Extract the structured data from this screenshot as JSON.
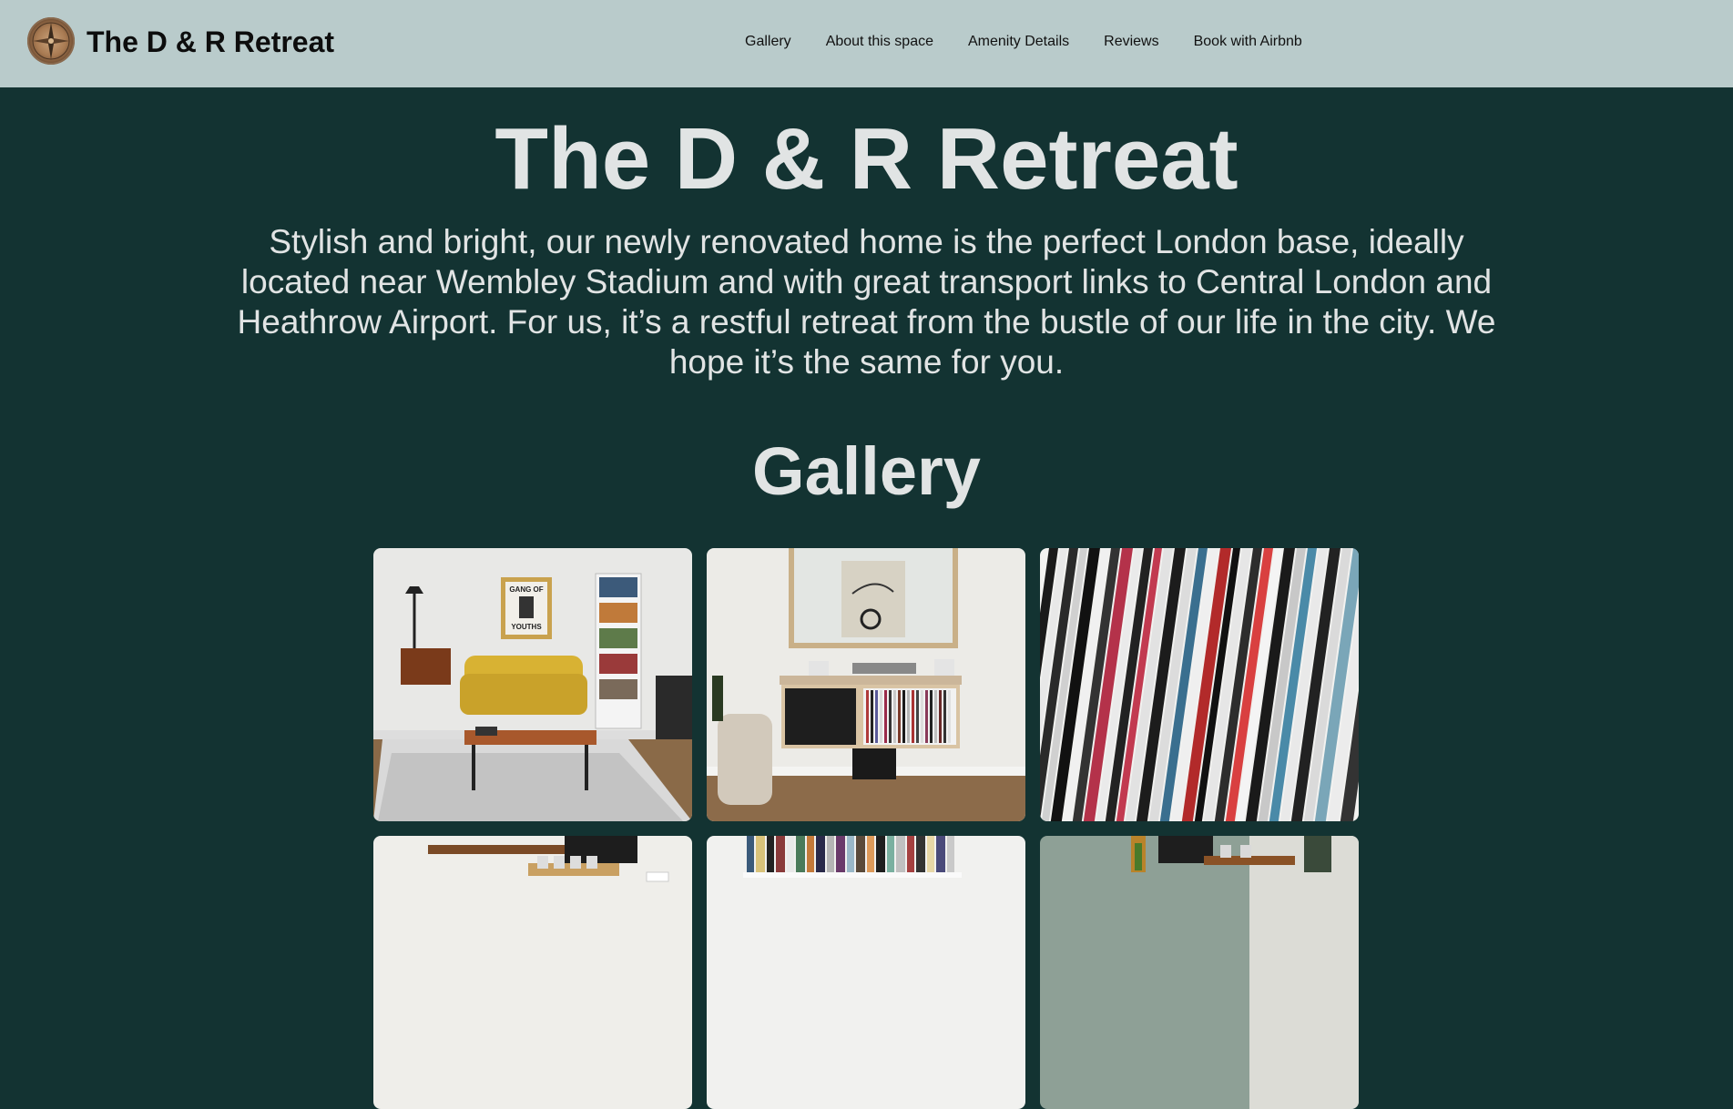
{
  "navbar": {
    "brand": "The D & R Retreat",
    "links": [
      {
        "label": "Gallery"
      },
      {
        "label": "About this space"
      },
      {
        "label": "Amenity Details"
      },
      {
        "label": "Reviews"
      },
      {
        "label": "Book with Airbnb"
      }
    ]
  },
  "hero": {
    "title": "The D & R Retreat",
    "description": "Stylish and bright, our newly renovated home is the perfect London base, ideally located near Wembley Stadium and with great transport links to Central London and Heathrow Airport. For us, it’s a restful retreat from the bustle of our life in the city. We hope it’s the same for you."
  },
  "gallery": {
    "title": "Gallery",
    "poster_text_line1": "GANG OF",
    "poster_text_line2": "YOUTHS"
  },
  "colors": {
    "navbar_bg": "#b9cbcb",
    "page_bg": "#133332",
    "heading_text": "#e1e4e4"
  }
}
